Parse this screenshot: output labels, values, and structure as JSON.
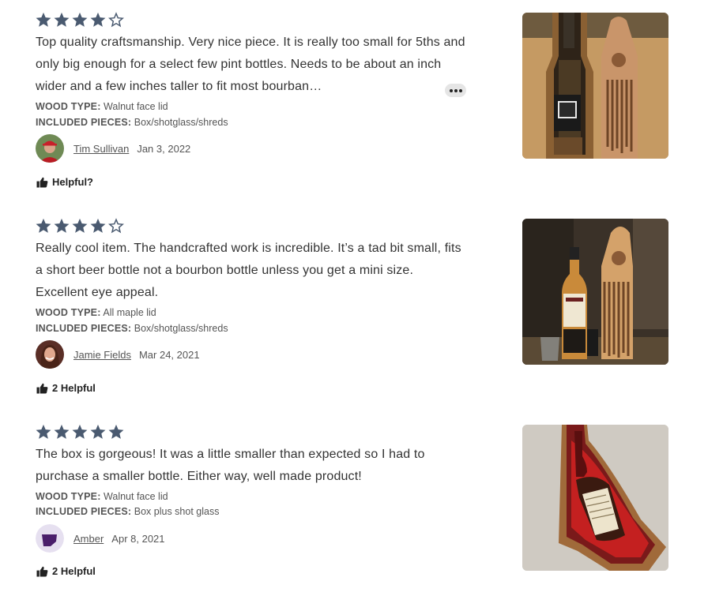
{
  "colors": {
    "star": "#4a5a70",
    "text": "#333333",
    "meta": "#555555"
  },
  "reviews": [
    {
      "rating": 4,
      "text": "Top quality craftsmanship. Very nice piece. It is really too small for 5ths and only big enough for a select few pint bottles. Needs to be about an inch wider and a few inches taller to fit most bourban…",
      "attributes": [
        {
          "label": "WOOD TYPE:",
          "value": "Walnut face lid"
        },
        {
          "label": "INCLUDED PIECES:",
          "value": "Box/shotglass/shreds"
        }
      ],
      "reviewer": "Tim Sullivan",
      "date": "Jan 3, 2022",
      "helpful": "Helpful?",
      "photo_icon": "photo-open-box-with-bottle"
    },
    {
      "rating": 4,
      "text": "Really cool item. The handcrafted work is incredible. It’s a tad bit small, fits a short beer bottle not a bourbon bottle unless you get a mini size. Excellent eye appeal.",
      "attributes": [
        {
          "label": "WOOD TYPE:",
          "value": "All maple lid"
        },
        {
          "label": "INCLUDED PIECES:",
          "value": "Box/shotglass/shreds"
        }
      ],
      "reviewer": "Jamie Fields",
      "date": "Mar 24, 2021",
      "helpful": "2 Helpful",
      "photo_icon": "photo-bottle-and-lid"
    },
    {
      "rating": 5,
      "text": "The box is gorgeous! It was a little smaller than expected so I had to purchase a smaller bottle. Either way, well made product!",
      "attributes": [
        {
          "label": "WOOD TYPE:",
          "value": "Walnut face lid"
        },
        {
          "label": "INCLUDED PIECES:",
          "value": "Box plus shot glass"
        }
      ],
      "reviewer": "Amber",
      "date": "Apr 8, 2021",
      "helpful": "2 Helpful",
      "photo_icon": "photo-box-with-red-shreds"
    }
  ]
}
